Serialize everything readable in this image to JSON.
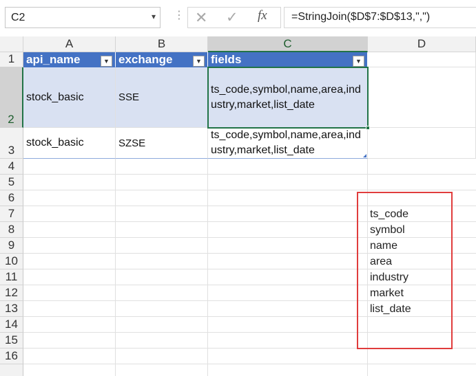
{
  "formula_bar": {
    "name_box": "C2",
    "formula": "=StringJoin($D$7:$D$13,\",\")"
  },
  "columns": [
    "A",
    "B",
    "C",
    "D"
  ],
  "rows": [
    "1",
    "2",
    "3",
    "4",
    "5",
    "6",
    "7",
    "8",
    "9",
    "10",
    "11",
    "12",
    "13",
    "14",
    "15",
    "16"
  ],
  "selected_column": "C",
  "selected_row": "2",
  "table": {
    "headers": [
      "api_name",
      "exchange",
      "fields"
    ],
    "rows": [
      [
        "stock_basic",
        "SSE",
        "ts_code,symbol,name,area,industry,market,list_date"
      ],
      [
        "stock_basic",
        "SZSE",
        "ts_code,symbol,name,area,industry,market,list_date"
      ]
    ]
  },
  "d_values": [
    "ts_code",
    "symbol",
    "name",
    "area",
    "industry",
    "market",
    "list_date"
  ],
  "colors": {
    "table_header": "#4472c4",
    "band_row": "#d9e1f2",
    "selection": "#217346",
    "highlight_box": "#e03c3c"
  }
}
